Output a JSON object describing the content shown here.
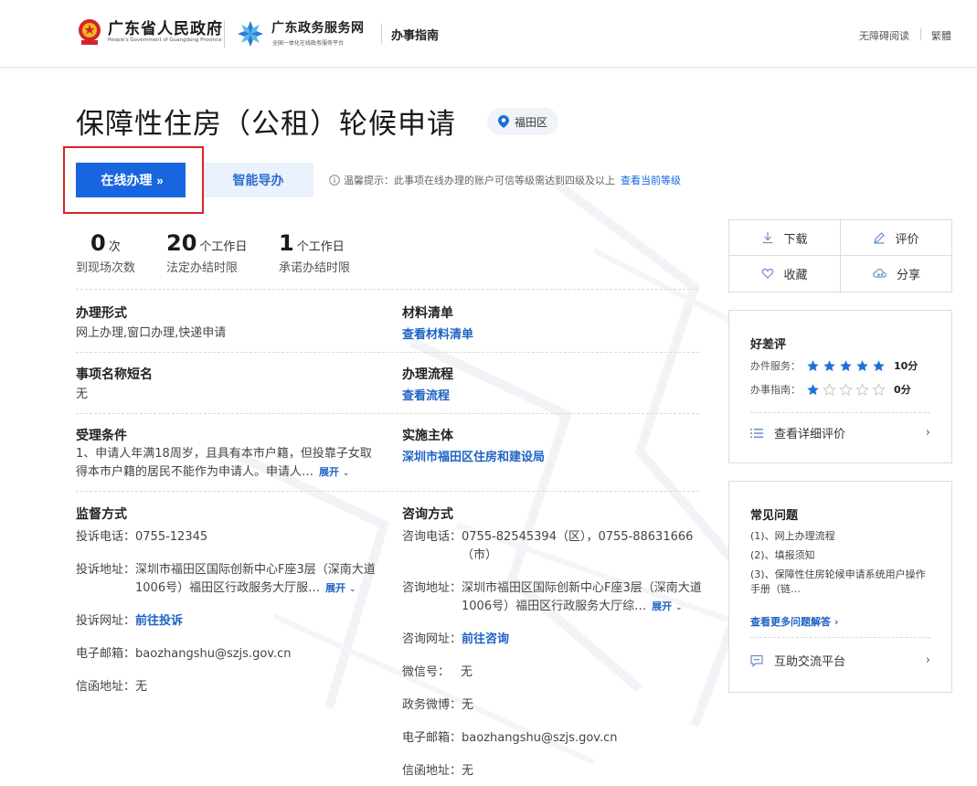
{
  "header": {
    "gov_title": "广东省人民政府",
    "gov_subtitle": "People's Government of Guangdong Province",
    "gd_title": "广东政务服务网",
    "gd_subtitle": "全国一体化在线政务服务平台",
    "guide_title": "办事指南",
    "accessible_reading": "无障碍阅读",
    "traditional": "繁體"
  },
  "page": {
    "title": "保障性住房（公租）轮候申请",
    "region": "福田区"
  },
  "actions_top": {
    "online_label": "在线办理",
    "online_chevron": "»",
    "guide_label": "智能导办",
    "tip_text": "温馨提示：此事项在线办理的账户可信等级需达到四级及以上",
    "tip_link": "查看当前等级"
  },
  "stats": [
    {
      "num": "0",
      "unit": "次",
      "label": "到现场次数"
    },
    {
      "num": "20",
      "unit": "个工作日",
      "label": "法定办结时限"
    },
    {
      "num": "1",
      "unit": "个工作日",
      "label": "承诺办结时限"
    }
  ],
  "info": {
    "handling_form": {
      "title": "办理形式",
      "value": "网上办理,窗口办理,快递申请"
    },
    "materials": {
      "title": "材料清单",
      "link": "查看材料清单"
    },
    "short_name": {
      "title": "事项名称短名",
      "value": "无"
    },
    "process": {
      "title": "办理流程",
      "link": "查看流程"
    },
    "conditions": {
      "title": "受理条件",
      "value_line1": "1、申请人年满18周岁，且具有本市户籍，但投靠子女取",
      "value_line2": "得本市户籍的居民不能作为申请人。申请人…",
      "expand": "展开"
    },
    "implementer": {
      "title": "实施主体",
      "link": "深圳市福田区住房和建设局"
    }
  },
  "supervision": {
    "title": "监督方式",
    "phone_label": "投诉电话：",
    "phone": "0755-12345",
    "address_label": "投诉地址：",
    "address_line1": "深圳市福田区国际创新中心F座3层（深南大道",
    "address_line2": "1006号）福田区行政服务大厅服…",
    "expand": "展开",
    "web_label": "投诉网址：",
    "web_link": "前往投诉",
    "email_label": "电子邮箱：",
    "email": "baozhangshu@szjs.gov.cn",
    "letter_label": "信函地址：",
    "letter": "无"
  },
  "consult": {
    "title": "咨询方式",
    "phone_label": "咨询电话：",
    "phone_line1": "0755-82545394（区），0755-88631666",
    "phone_line2": "（市）",
    "address_label": "咨询地址：",
    "address_line1": "深圳市福田区国际创新中心F座3层（深南大道",
    "address_line2": "1006号）福田区行政服务大厅综…",
    "expand": "展开",
    "web_label": "咨询网址：",
    "web_link": "前往咨询",
    "wechat_label": "微信号：",
    "wechat": "无",
    "weibo_label": "政务微博：",
    "weibo": "无",
    "email_label": "电子邮箱：",
    "email": "baozhangshu@szjs.gov.cn",
    "letter_label": "信函地址：",
    "letter": "无"
  },
  "sidebar": {
    "download": "下载",
    "evaluate": "评价",
    "favorite": "收藏",
    "share": "分享",
    "rating_title": "好差评",
    "service_label": "办件服务：",
    "service_stars": 5,
    "service_score": "10分",
    "guide_label": "办事指南：",
    "guide_stars": 1,
    "guide_score": "0分",
    "detail_link": "查看详细评价",
    "faq_title": "常见问题",
    "faq_items": [
      "(1)、网上办理流程",
      "(2)、填报须知",
      "(3)、保障性住房轮候申请系统用户操作手册（链…"
    ],
    "faq_more": "查看更多问题解答",
    "platform_link": "互助交流平台"
  },
  "colors": {
    "primary": "#1766e0",
    "link": "#1e63c4",
    "highlight_box": "#d9242a",
    "star_on": "#1e6fd9",
    "star_off": "#c8c8c8"
  }
}
